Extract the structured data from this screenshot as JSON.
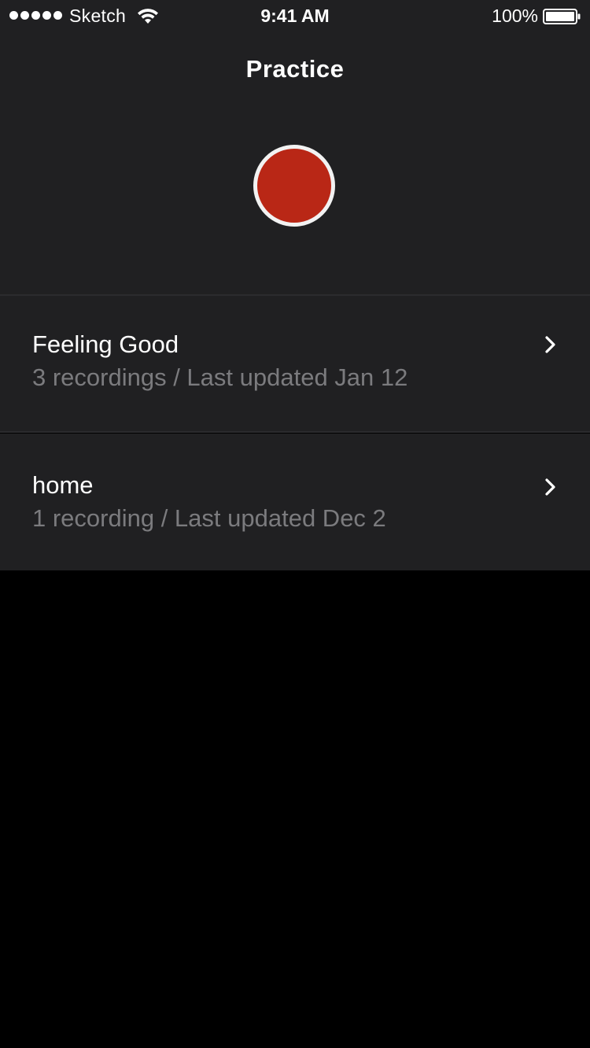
{
  "status_bar": {
    "carrier": "Sketch",
    "time": "9:41 AM",
    "battery": "100%"
  },
  "nav": {
    "title": "Practice"
  },
  "colors": {
    "panel": "#202022",
    "record_fill": "#b92716",
    "record_ring": "#f2f2f2",
    "subtitle": "#7b7b7e",
    "background": "#000000"
  },
  "recordings": [
    {
      "title": "Feeling Good",
      "subtitle": "3 recordings / Last updated Jan 12",
      "icon": "chevron-right-icon"
    },
    {
      "title": "home",
      "subtitle": "1 recording / Last updated Dec 2",
      "icon": "chevron-right-icon"
    }
  ]
}
